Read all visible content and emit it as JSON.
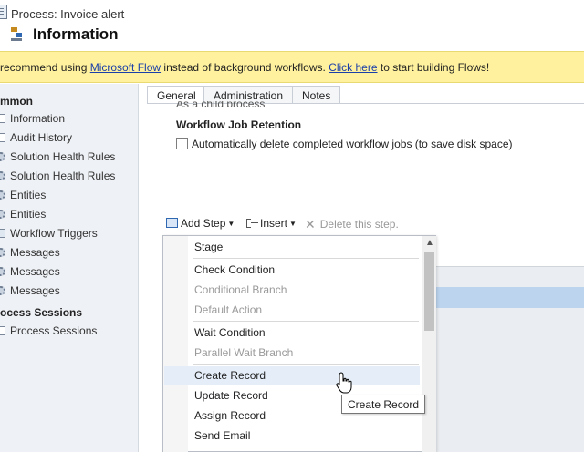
{
  "header": {
    "process_label": "Process: Invoice alert",
    "form_title": "Information"
  },
  "banner": {
    "text_before": "recommend using ",
    "link1": "Microsoft Flow",
    "text_middle": " instead of background workflows. ",
    "link2": "Click here",
    "text_after": " to start building Flows!"
  },
  "sidebar": {
    "section_common": "mmon",
    "items": [
      {
        "label": "Information",
        "icon": "document-icon"
      },
      {
        "label": "Audit History",
        "icon": "document-icon"
      },
      {
        "label": "Solution Health Rules",
        "icon": "gear-icon"
      },
      {
        "label": "Solution Health Rules",
        "icon": "gear-icon"
      },
      {
        "label": "Entities",
        "icon": "gear-icon"
      },
      {
        "label": "Entities",
        "icon": "gear-icon"
      },
      {
        "label": "Workflow Triggers",
        "icon": "trigger-icon"
      },
      {
        "label": "Messages",
        "icon": "gear-icon"
      },
      {
        "label": "Messages",
        "icon": "gear-icon"
      },
      {
        "label": "Messages",
        "icon": "gear-icon"
      }
    ],
    "section_sessions": "ocess Sessions",
    "session_items": [
      {
        "label": "Process Sessions",
        "icon": "document-icon"
      }
    ]
  },
  "tabs": [
    {
      "label": "General",
      "active": true
    },
    {
      "label": "Administration",
      "active": false
    },
    {
      "label": "Notes",
      "active": false
    }
  ],
  "general": {
    "partial_text": "As a child process",
    "retention_title": "Workflow Job Retention",
    "auto_delete_label": "Automatically delete completed workflow jobs (to save disk space)",
    "auto_delete_checked": false
  },
  "step_toolbar": {
    "add_step": "Add Step",
    "insert": "Insert",
    "delete": "Delete this step."
  },
  "add_step_menu": {
    "items": [
      {
        "label": "Stage",
        "enabled": true
      },
      {
        "label": "Check Condition",
        "enabled": true
      },
      {
        "label": "Conditional Branch",
        "enabled": false
      },
      {
        "label": "Default Action",
        "enabled": false
      },
      {
        "label": "Wait Condition",
        "enabled": true
      },
      {
        "label": "Parallel Wait Branch",
        "enabled": false
      },
      {
        "label": "Create Record",
        "enabled": true,
        "hovered": true
      },
      {
        "label": "Update Record",
        "enabled": true
      },
      {
        "label": "Assign Record",
        "enabled": true
      },
      {
        "label": "Send Email",
        "enabled": true
      }
    ]
  },
  "tooltip": {
    "text": "Create Record"
  },
  "colors": {
    "banner_bg": "#fff19d",
    "link": "#1a3eaa",
    "sidebar_bg": "#eef1f5",
    "menu_hover": "#e5eef8",
    "selected_step": "#bcd4ee"
  }
}
